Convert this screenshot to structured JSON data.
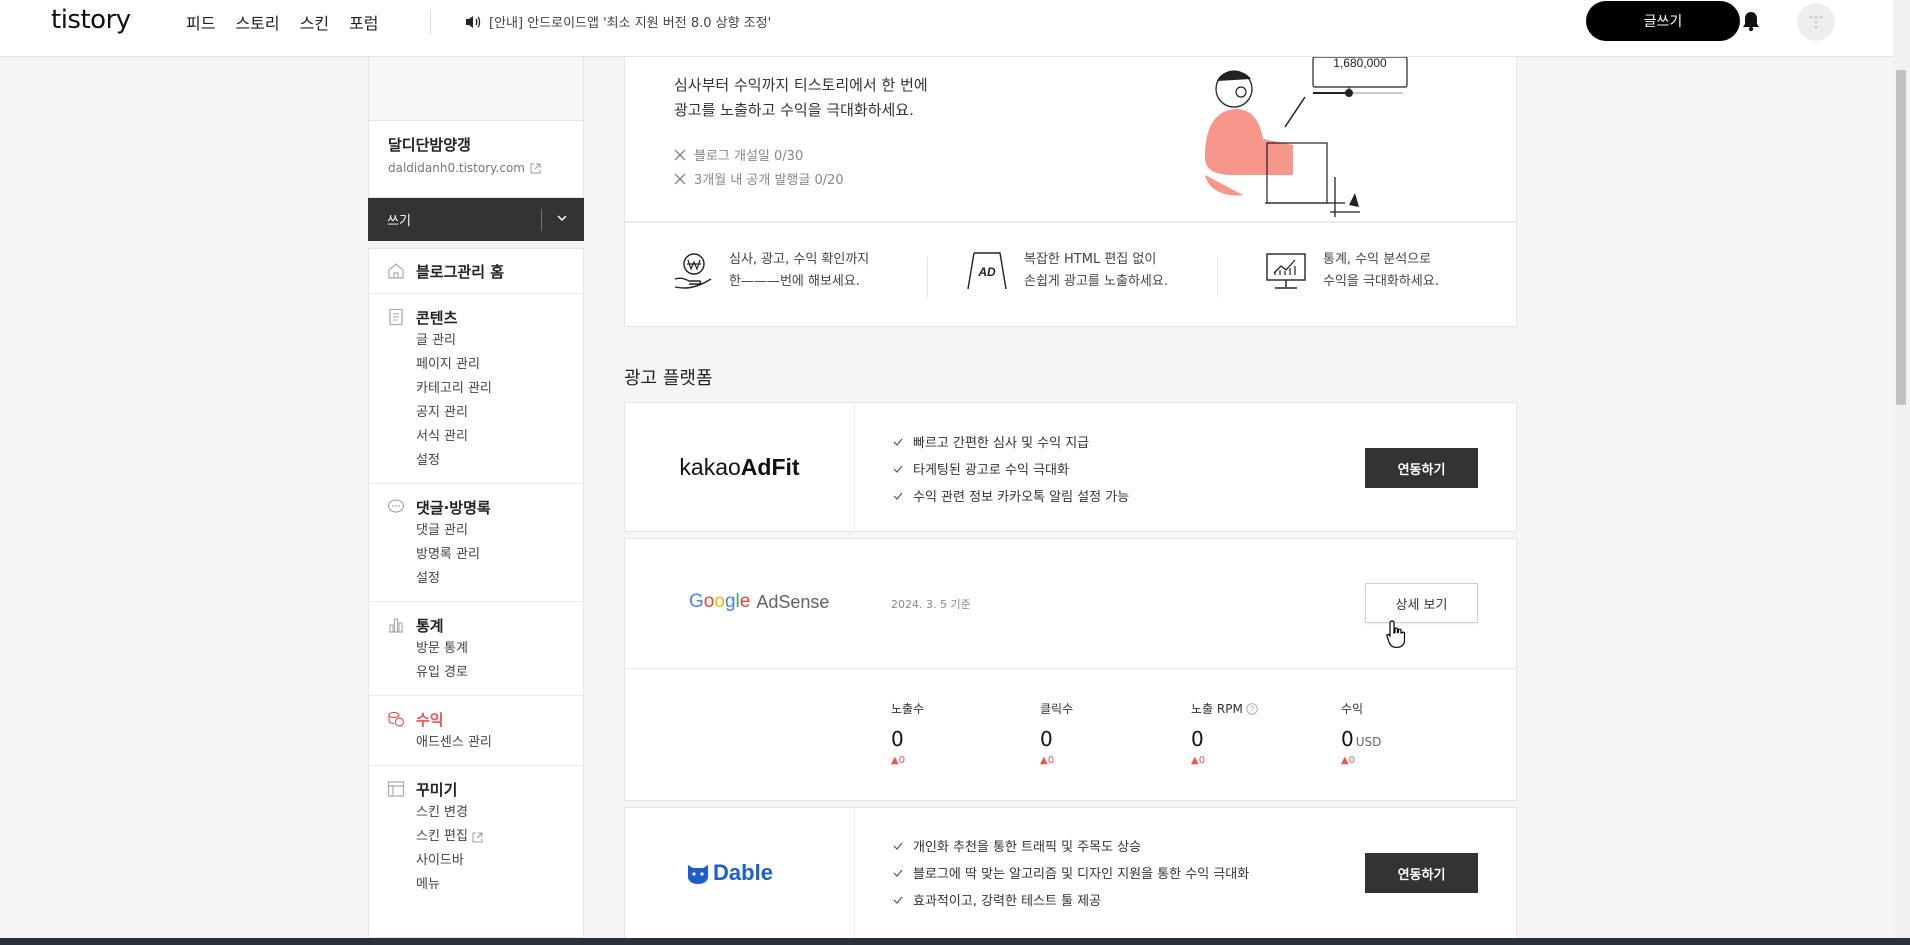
{
  "header": {
    "logo": "tistory",
    "nav": [
      "피드",
      "스토리",
      "스킨",
      "포럼"
    ],
    "notice": "[안내] 안드로이드앱 '최소 지원 버전 8.0 상향 조정'",
    "write_label": "글쓰기"
  },
  "sidebar": {
    "blog_name": "달디단밤양갱",
    "blog_url": "daldidanh0.tistory.com",
    "write_label": "쓰기",
    "groups": [
      {
        "title": "블로그관리 홈",
        "icon": "home-icon",
        "items": []
      },
      {
        "title": "콘텐츠",
        "icon": "document-icon",
        "items": [
          "글 관리",
          "페이지 관리",
          "카테고리 관리",
          "공지 관리",
          "서식 관리",
          "설정"
        ]
      },
      {
        "title": "댓글·방명록",
        "icon": "comment-icon",
        "items": [
          "댓글 관리",
          "방명록 관리",
          "설정"
        ]
      },
      {
        "title": "통계",
        "icon": "bar-chart-icon",
        "items": [
          "방문 통계",
          "유입 경로"
        ]
      },
      {
        "title": "수익",
        "icon": "coins-icon",
        "items": [
          "애드센스 관리"
        ]
      },
      {
        "title": "꾸미기",
        "icon": "layout-icon",
        "items": [
          "스킨 변경",
          "스킨 편집",
          "사이드바",
          "메뉴"
        ]
      }
    ]
  },
  "hero": {
    "line1": "심사부터 수익까지 티스토리에서 한 번에",
    "line2": "광고를 노출하고 수익을 극대화하세요.",
    "req1": "블로그 개설일 0/30",
    "req2": "3개월 내 공개 발행글 0/20",
    "illustration_value": "1,680,000"
  },
  "features": [
    {
      "icon": "won-hand-icon",
      "l1": "심사, 광고, 수익 확인까지",
      "l2": "한———번에 해보세요."
    },
    {
      "icon": "ad-sign-icon",
      "l1": "복잡한 HTML 편집 없이",
      "l2": "손쉽게 광고를 노출하세요."
    },
    {
      "icon": "monitor-chart-icon",
      "l1": "통계, 수익 분석으로",
      "l2": "수익을 극대화하세요."
    }
  ],
  "platform_title": "광고 플랫폼",
  "adfit": {
    "logo_a": "kakao",
    "logo_b": "AdFit",
    "bullets": [
      "빠르고 간편한 심사 및 수익 지급",
      "타게팅된 광고로 수익 극대화",
      "수익 관련 정보 카카오톡 알림 설정 가능"
    ],
    "button": "연동하기"
  },
  "adsense": {
    "logo_google": "Google",
    "logo_adsense": "AdSense",
    "date": "2024. 3. 5 기준",
    "button": "상세 보기",
    "stats": [
      {
        "label": "노출수",
        "value": "0",
        "unit": "",
        "change": "0"
      },
      {
        "label": "클릭수",
        "value": "0",
        "unit": "",
        "change": "0"
      },
      {
        "label": "노출 RPM",
        "value": "0",
        "unit": "",
        "change": "0"
      },
      {
        "label": "수익",
        "value": "0",
        "unit": "USD",
        "change": "0"
      }
    ]
  },
  "dable": {
    "logo": "Dable",
    "bullets": [
      "개인화 추천을 통한 트래픽 및 주목도 상승",
      "블로그에 딱 맞는 알고리즘 및 디자인 지원을 통한 수익 극대화",
      "효과적이고, 강력한 테스트 툴 제공"
    ],
    "button": "연동하기"
  },
  "colors": {
    "accent": "#e9574f",
    "dark": "#333333",
    "adsense_blue": "#4285f4",
    "dable_blue": "#1b5fcc"
  }
}
